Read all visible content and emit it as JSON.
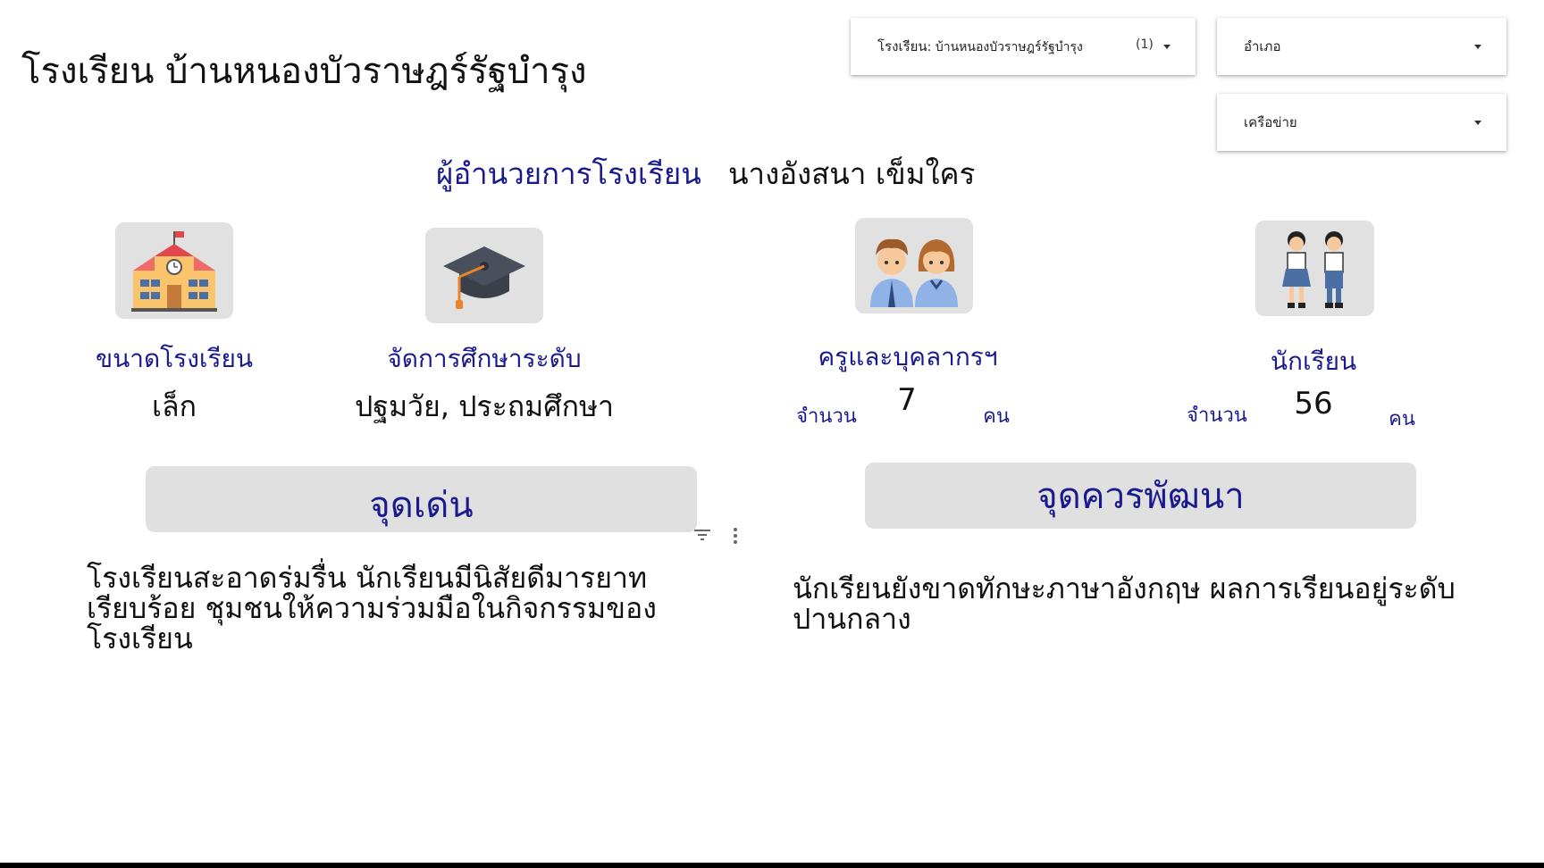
{
  "page": {
    "title": "โรงเรียน บ้านหนองบัวราษฎร์รัฐบำรุง"
  },
  "filters": {
    "school": {
      "label_prefix": "โรงเรียน",
      "label_value": ": บ้านหนองบัวราษฎร์รัฐบำรุง",
      "count": "(1)"
    },
    "district": {
      "label": "อำเภอ"
    },
    "network": {
      "label": "เครือข่าย"
    }
  },
  "director": {
    "label": "ผู้อำนวยการโรงเรียน",
    "name": "นางอังสนา เข็มใคร"
  },
  "stats": {
    "size": {
      "label": "ขนาดโรงเรียน",
      "value": "เล็ก",
      "icon": "school-building-icon"
    },
    "level": {
      "label": "จัดการศึกษาระดับ",
      "value": "ปฐมวัย, ประถมศึกษา",
      "icon": "graduation-cap-icon"
    },
    "teachers": {
      "label": "ครูและบุคลากรฯ",
      "prefix": "จำนวน",
      "value": "7",
      "unit": "คน",
      "icon": "teachers-icon"
    },
    "students": {
      "label": "นักเรียน",
      "prefix": "จำนวน",
      "value": "56",
      "unit": "คน",
      "icon": "students-icon"
    }
  },
  "strengths": {
    "title": "จุดเด่น",
    "text": "โรงเรียนสะอาดร่มรื่น นักเรียนมีนิสัยดีมารยาท เรียบร้อย ชุมชนให้ความร่วมมือในกิจกรรมของโรงเรียน"
  },
  "improvements": {
    "title": "จุดควรพัฒนา",
    "text": "นักเรียนยังขาดทักษะภาษาอังกฤษ ผลการเรียนอยู่ระดับปานกลาง"
  },
  "colors": {
    "accent": "#1a1a8f",
    "tile": "#e1e1e1",
    "bar": "#e0e0e0"
  }
}
